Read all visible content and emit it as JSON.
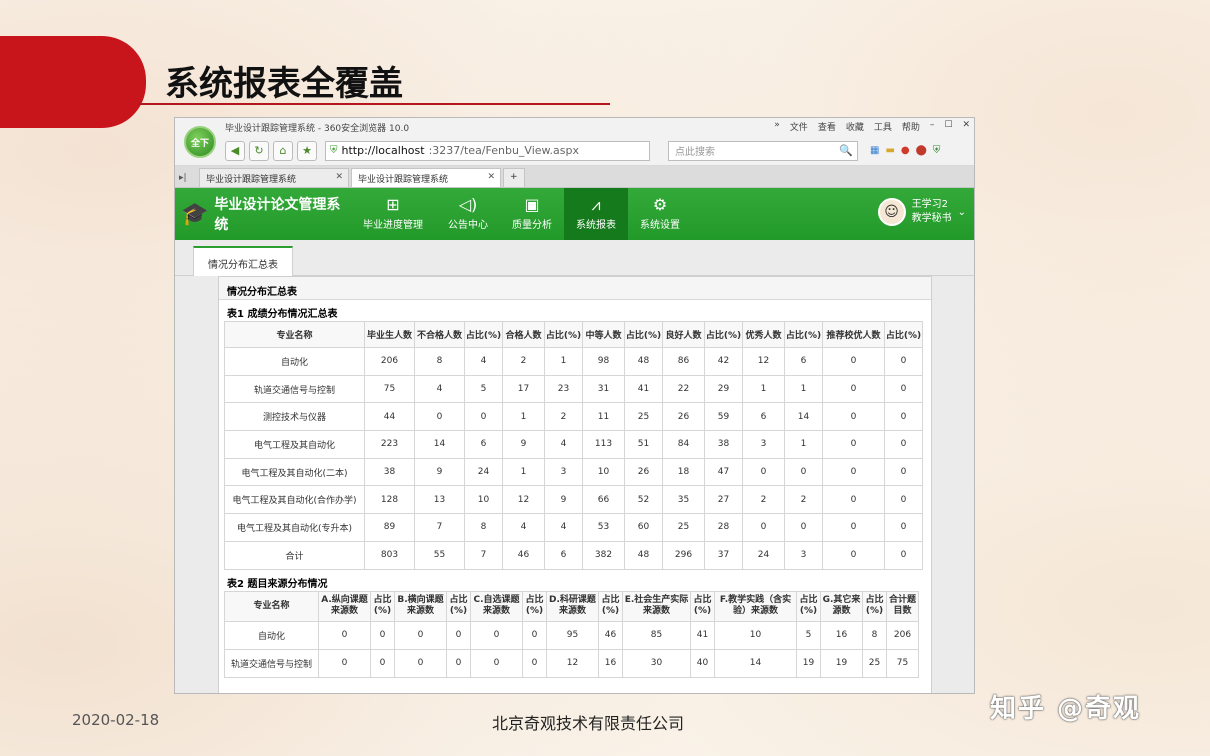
{
  "slide": {
    "title": "系统报表全覆盖",
    "date": "2020-02-18",
    "company": "北京奇观技术有限责任公司",
    "watermark": "知乎 @奇观",
    "accent_color": "#c8141b"
  },
  "browser": {
    "window_title": "毕业设计跟踪管理系统 - 360安全浏览器 10.0",
    "menus": [
      "»",
      "文件",
      "查看",
      "收藏",
      "工具",
      "帮助"
    ],
    "logo_text": "全下",
    "url_host": "http://localhost",
    "url_path": ":3237/tea/Fenbu_View.aspx",
    "search_placeholder": "点此搜索",
    "tabs": [
      {
        "label": "毕业设计跟踪管理系统"
      },
      {
        "label": "毕业设计跟踪管理系统"
      }
    ]
  },
  "app": {
    "name": "毕业设计论文管理系统",
    "brand_color": "#229a2a",
    "nav": [
      {
        "label": "毕业进度管理",
        "icon": "grid-icon"
      },
      {
        "label": "公告中心",
        "icon": "speaker-icon"
      },
      {
        "label": "质量分析",
        "icon": "monitor-icon"
      },
      {
        "label": "系统报表",
        "icon": "chart-icon"
      },
      {
        "label": "系统设置",
        "icon": "gear-icon"
      }
    ],
    "user": {
      "name": "王学习2",
      "role": "教学秘书"
    },
    "page_tab": "情况分布汇总表"
  },
  "panel": {
    "title": "情况分布汇总表",
    "table1": {
      "title": "表1 成绩分布情况汇总表",
      "headers": [
        "专业名称",
        "毕业生人数",
        "不合格人数",
        "占比(%)",
        "合格人数",
        "占比(%)",
        "中等人数",
        "占比(%)",
        "良好人数",
        "占比(%)",
        "优秀人数",
        "占比(%)",
        "推荐校优人数",
        "占比(%)"
      ],
      "rows": [
        [
          "自动化",
          "206",
          "8",
          "4",
          "2",
          "1",
          "98",
          "48",
          "86",
          "42",
          "12",
          "6",
          "0",
          "0"
        ],
        [
          "轨道交通信号与控制",
          "75",
          "4",
          "5",
          "17",
          "23",
          "31",
          "41",
          "22",
          "29",
          "1",
          "1",
          "0",
          "0"
        ],
        [
          "测控技术与仪器",
          "44",
          "0",
          "0",
          "1",
          "2",
          "11",
          "25",
          "26",
          "59",
          "6",
          "14",
          "0",
          "0"
        ],
        [
          "电气工程及其自动化",
          "223",
          "14",
          "6",
          "9",
          "4",
          "113",
          "51",
          "84",
          "38",
          "3",
          "1",
          "0",
          "0"
        ],
        [
          "电气工程及其自动化(二本)",
          "38",
          "9",
          "24",
          "1",
          "3",
          "10",
          "26",
          "18",
          "47",
          "0",
          "0",
          "0",
          "0"
        ],
        [
          "电气工程及其自动化(合作办学)",
          "128",
          "13",
          "10",
          "12",
          "9",
          "66",
          "52",
          "35",
          "27",
          "2",
          "2",
          "0",
          "0"
        ],
        [
          "电气工程及其自动化(专升本)",
          "89",
          "7",
          "8",
          "4",
          "4",
          "53",
          "60",
          "25",
          "28",
          "0",
          "0",
          "0",
          "0"
        ],
        [
          "合计",
          "803",
          "55",
          "7",
          "46",
          "6",
          "382",
          "48",
          "296",
          "37",
          "24",
          "3",
          "0",
          "0"
        ]
      ]
    },
    "table2": {
      "title": "表2 题目来源分布情况",
      "headers": [
        "专业名称",
        "A.纵向课题来源数",
        "占比(%)",
        "B.横向课题来源数",
        "占比(%)",
        "C.自选课题来源数",
        "占比(%)",
        "D.科研课题来源数",
        "占比(%)",
        "E.社会生产实际来源数",
        "占比(%)",
        "F.教学实践（含实验）来源数",
        "占比(%)",
        "G.其它来源数",
        "占比(%)",
        "合计题目数"
      ],
      "rows": [
        [
          "自动化",
          "0",
          "0",
          "0",
          "0",
          "0",
          "0",
          "95",
          "46",
          "85",
          "41",
          "10",
          "5",
          "16",
          "8",
          "206"
        ],
        [
          "轨道交通信号与控制",
          "0",
          "0",
          "0",
          "0",
          "0",
          "0",
          "12",
          "16",
          "30",
          "40",
          "14",
          "19",
          "19",
          "25",
          "75"
        ]
      ]
    }
  }
}
